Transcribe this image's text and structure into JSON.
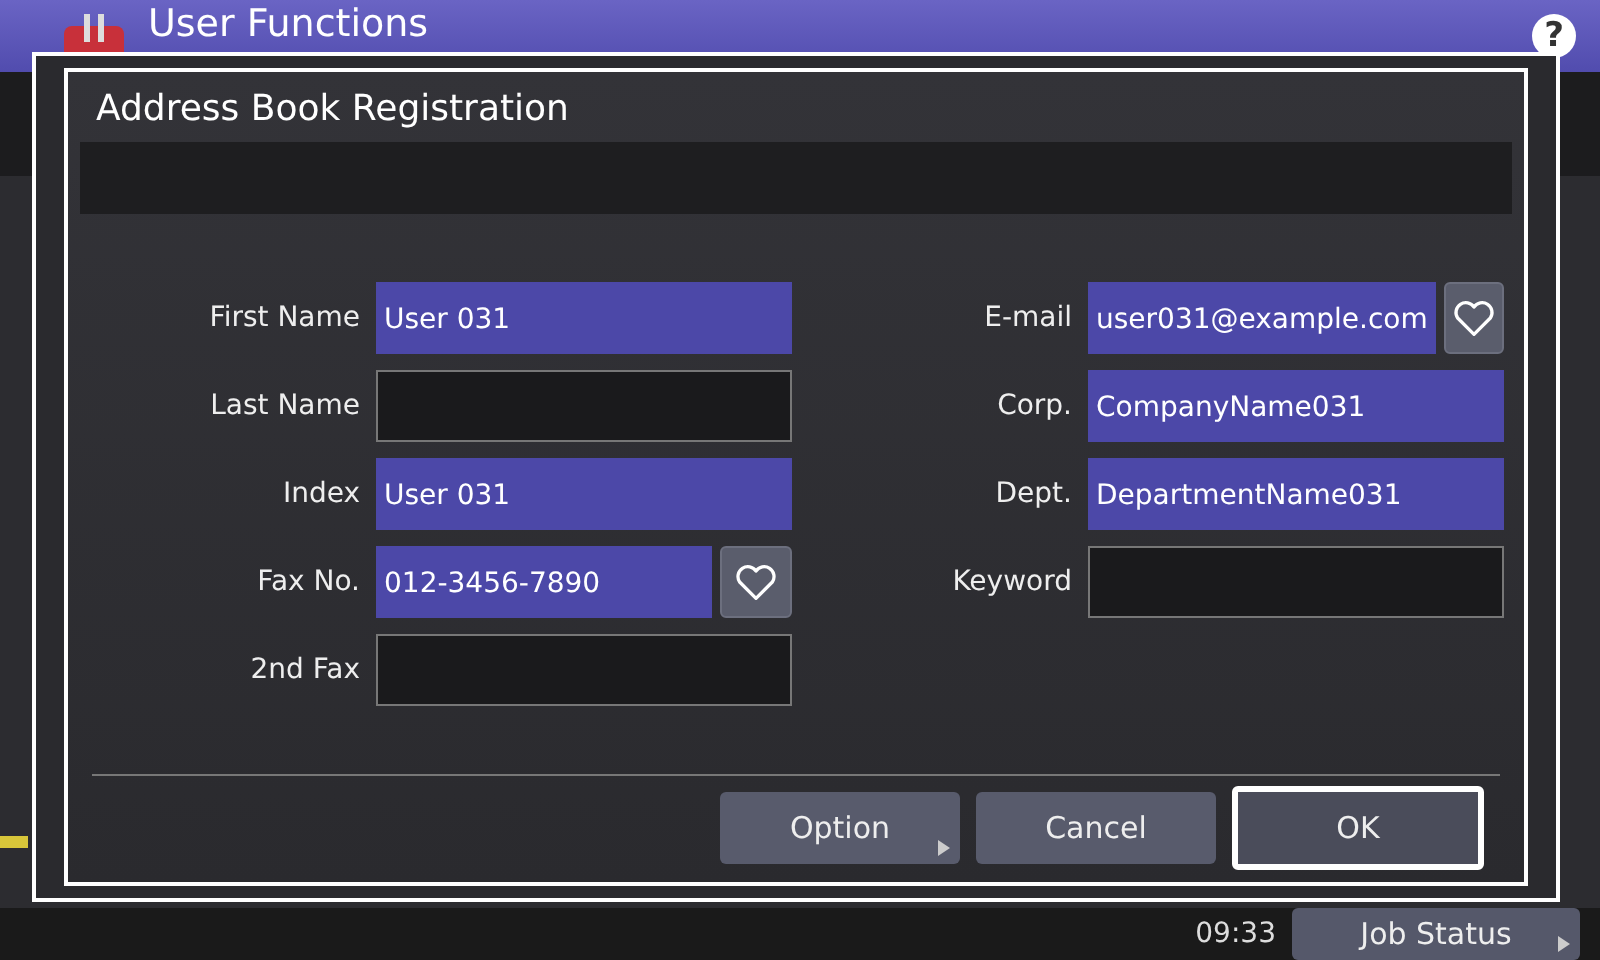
{
  "app_header": {
    "title": "User Functions",
    "help_label": "?"
  },
  "status_bar": {
    "time": "09:33",
    "job_status_button": "Job Status"
  },
  "dialog": {
    "title": "Address Book Registration",
    "left_fields": [
      {
        "label": "First Name",
        "value": "User 031",
        "kind": "text"
      },
      {
        "label": "Last Name",
        "kind": "text"
      },
      {
        "label": "Index",
        "value": "User 031",
        "kind": "text"
      },
      {
        "label": "Fax No.",
        "value": "012-3456-7890",
        "kind": "favorite"
      },
      {
        "label": "2nd Fax",
        "kind": "text"
      }
    ],
    "right_fields": [
      {
        "label": "E-mail",
        "value": "user031@example.com",
        "kind": "favorite"
      },
      {
        "label": "Corp.",
        "value": "CompanyName031",
        "kind": "text"
      },
      {
        "label": "Dept.",
        "value": "DepartmentName031",
        "kind": "text"
      },
      {
        "label": "Keyword",
        "kind": "text"
      }
    ],
    "buttons": [
      {
        "label": "Option",
        "selected": false,
        "submenu": true
      },
      {
        "label": "Cancel",
        "selected": false,
        "submenu": false
      },
      {
        "label": "OK",
        "selected": true,
        "submenu": false
      }
    ]
  }
}
